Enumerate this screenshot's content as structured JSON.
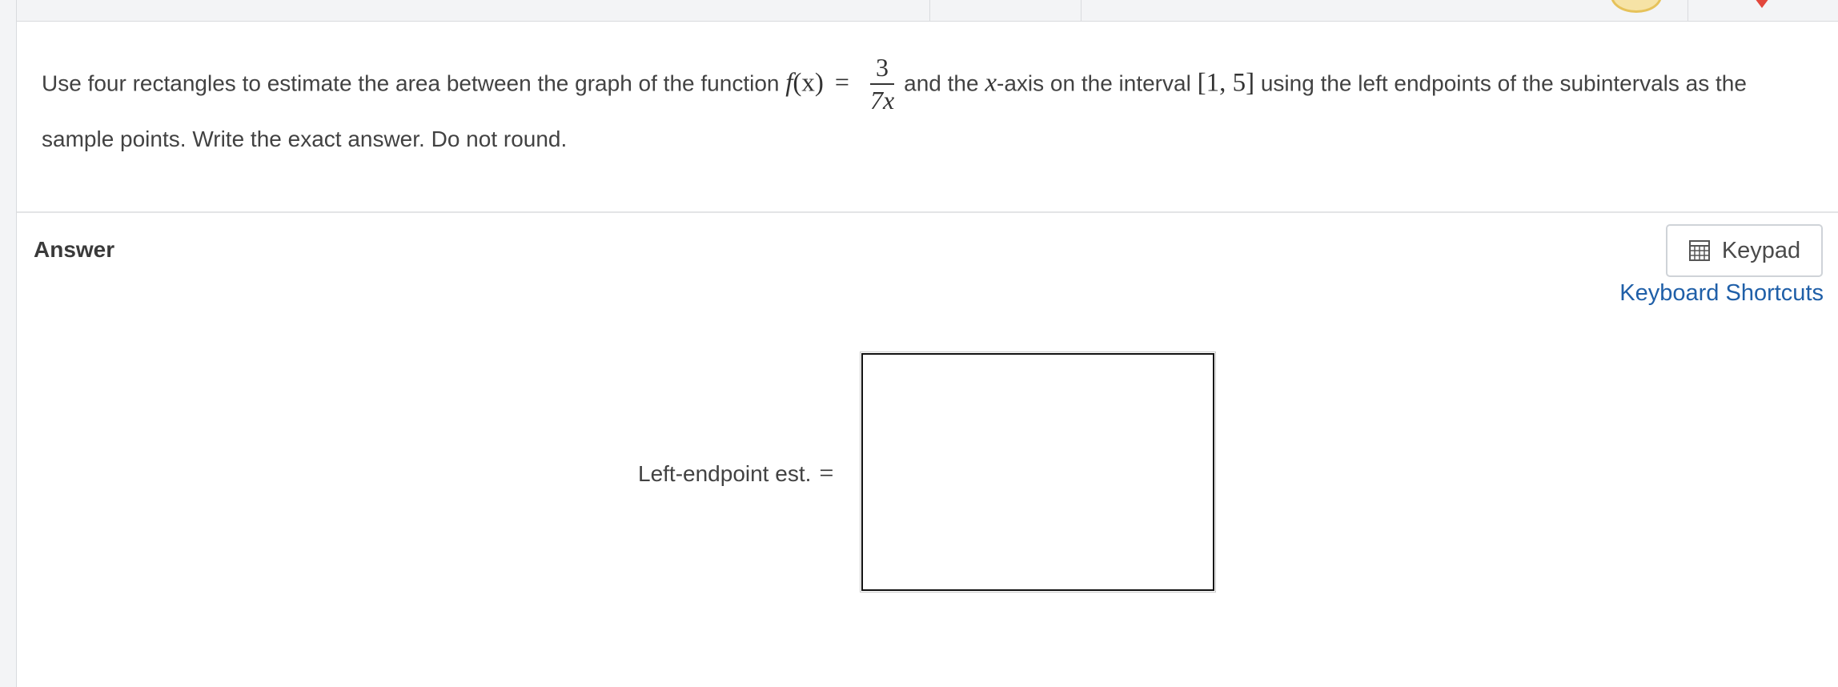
{
  "question": {
    "text_before": "Use four rectangles to estimate the area between the graph of the function ",
    "function_name": "f",
    "function_arg": "(x)",
    "equals": "=",
    "fraction_numerator": "3",
    "fraction_denominator": "7x",
    "text_middle_1": "and the ",
    "axis_var": "x",
    "text_middle_2": "-axis on the interval ",
    "interval": "[1, 5]",
    "text_after": " using the left endpoints of the subintervals as the sample points. Write the exact answer. Do not round."
  },
  "answer": {
    "heading": "Answer",
    "keypad_label": "Keypad",
    "shortcuts_label": "Keyboard Shortcuts",
    "input_label": "Left-endpoint est.",
    "input_equals": "=",
    "input_value": ""
  },
  "icons": {
    "keypad": "calculator-icon",
    "coin": "coin-icon",
    "heart": "heart-icon"
  },
  "colors": {
    "link": "#1f5fa8",
    "heart": "#e2473c",
    "coin": "#f6e3a6"
  }
}
